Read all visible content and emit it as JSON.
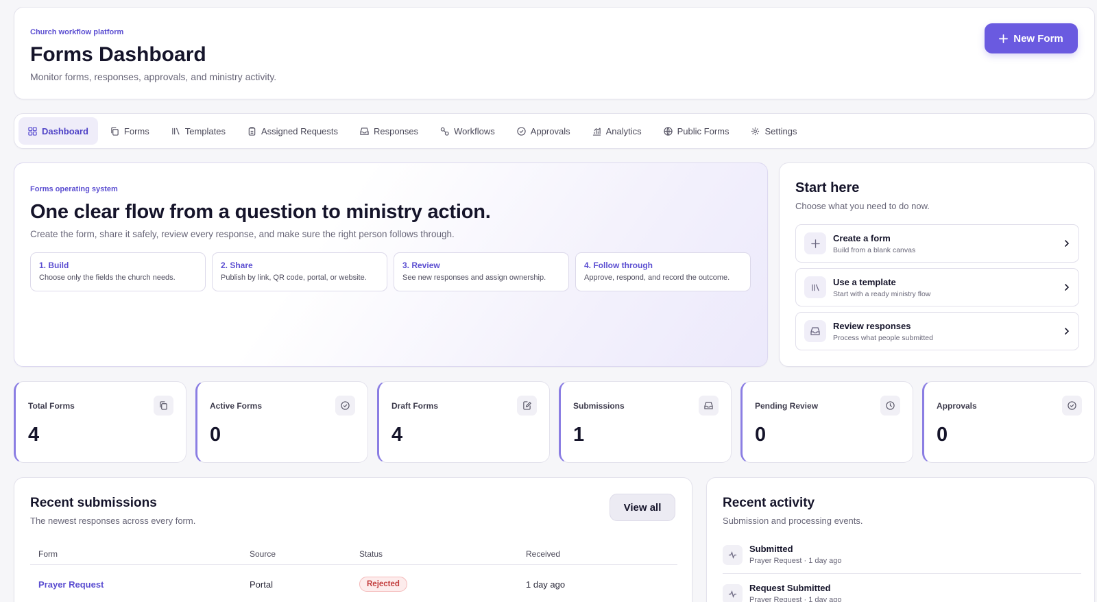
{
  "header": {
    "eyebrow": "Church workflow platform",
    "title": "Forms Dashboard",
    "subtitle": "Monitor forms, responses, approvals, and ministry activity.",
    "new_form_label": "New Form"
  },
  "nav": {
    "items": [
      {
        "label": "Dashboard",
        "icon": "grid-icon",
        "active": true
      },
      {
        "label": "Forms",
        "icon": "copy-icon"
      },
      {
        "label": "Templates",
        "icon": "library-icon"
      },
      {
        "label": "Assigned Requests",
        "icon": "clipboard-icon"
      },
      {
        "label": "Responses",
        "icon": "inbox-icon"
      },
      {
        "label": "Workflows",
        "icon": "workflow-icon"
      },
      {
        "label": "Approvals",
        "icon": "check-circle-icon"
      },
      {
        "label": "Analytics",
        "icon": "chart-icon"
      },
      {
        "label": "Public Forms",
        "icon": "globe-icon"
      },
      {
        "label": "Settings",
        "icon": "gear-icon"
      }
    ]
  },
  "hero": {
    "eyebrow": "Forms operating system",
    "title": "One clear flow from a question to ministry action.",
    "subtitle": "Create the form, share it safely, review every response, and make sure the right person follows through.",
    "steps": [
      {
        "title": "1. Build",
        "desc": "Choose only the fields the church needs."
      },
      {
        "title": "2. Share",
        "desc": "Publish by link, QR code, portal, or website."
      },
      {
        "title": "3. Review",
        "desc": "See new responses and assign ownership."
      },
      {
        "title": "4. Follow through",
        "desc": "Approve, respond, and record the outcome."
      }
    ]
  },
  "start": {
    "title": "Start here",
    "subtitle": "Choose what you need to do now.",
    "actions": [
      {
        "title": "Create a form",
        "desc": "Build from a blank canvas",
        "icon": "plus-icon"
      },
      {
        "title": "Use a template",
        "desc": "Start with a ready ministry flow",
        "icon": "library-icon"
      },
      {
        "title": "Review responses",
        "desc": "Process what people submitted",
        "icon": "inbox-icon"
      }
    ]
  },
  "stats": [
    {
      "label": "Total Forms",
      "value": "4",
      "icon": "copy-icon"
    },
    {
      "label": "Active Forms",
      "value": "0",
      "icon": "check-circle-icon"
    },
    {
      "label": "Draft Forms",
      "value": "4",
      "icon": "edit-icon"
    },
    {
      "label": "Submissions",
      "value": "1",
      "icon": "inbox-icon"
    },
    {
      "label": "Pending Review",
      "value": "0",
      "icon": "clock-icon"
    },
    {
      "label": "Approvals",
      "value": "0",
      "icon": "check-circle-icon"
    }
  ],
  "submissions": {
    "title": "Recent submissions",
    "subtitle": "The newest responses across every form.",
    "view_all_label": "View all",
    "columns": [
      "Form",
      "Source",
      "Status",
      "Received"
    ],
    "rows": [
      {
        "form": "Prayer Request",
        "source": "Portal",
        "status": "Rejected",
        "received": "1 day ago"
      }
    ]
  },
  "activity": {
    "title": "Recent activity",
    "subtitle": "Submission and processing events.",
    "items": [
      {
        "title": "Submitted",
        "desc": "Prayer Request · 1 day ago"
      },
      {
        "title": "Request Submitted",
        "desc": "Prayer Request · 1 day ago"
      }
    ]
  },
  "colors": {
    "accent": "#6a5ae0",
    "accent_text": "#5b4ed1",
    "rejected": "#c23b3b"
  }
}
